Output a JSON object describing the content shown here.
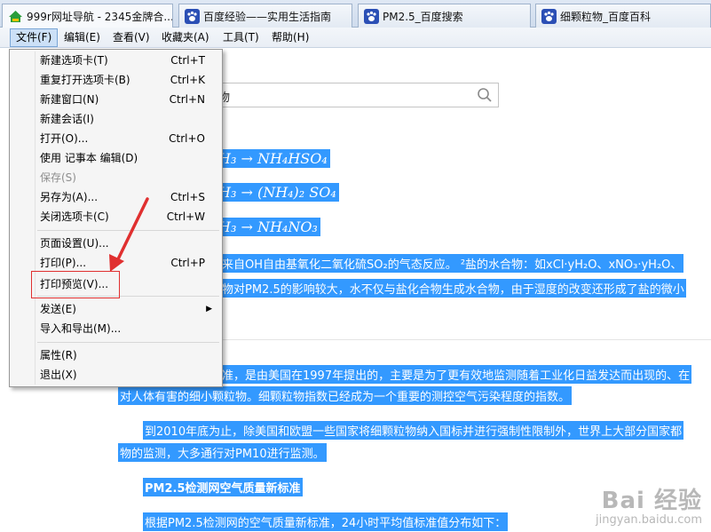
{
  "tabs": [
    {
      "label": "999r网址导航 - 2345金牌合...",
      "icon": "site-2345-icon"
    },
    {
      "label": "百度经验——实用生活指南",
      "icon": "baidu-paw-icon"
    },
    {
      "label": "PM2.5_百度搜索",
      "icon": "baidu-paw-icon"
    },
    {
      "label": "细颗粒物_百度百科",
      "icon": "baidu-paw-icon"
    }
  ],
  "menubar": {
    "file": "文件(F)",
    "edit": "编辑(E)",
    "view": "查看(V)",
    "favorites": "收藏夹(A)",
    "tools": "工具(T)",
    "help": "帮助(H)"
  },
  "file_menu": {
    "new_tab": {
      "label": "新建选项卡(T)",
      "shortcut": "Ctrl+T"
    },
    "reopen_tab": {
      "label": "重复打开选项卡(B)",
      "shortcut": "Ctrl+K"
    },
    "new_window": {
      "label": "新建窗口(N)",
      "shortcut": "Ctrl+N"
    },
    "new_session": {
      "label": "新建会话(I)"
    },
    "open": {
      "label": "打开(O)...",
      "shortcut": "Ctrl+O"
    },
    "edit_with": {
      "label": "使用 记事本 编辑(D)"
    },
    "save": {
      "label": "保存(S)"
    },
    "save_as": {
      "label": "另存为(A)...",
      "shortcut": "Ctrl+S"
    },
    "close_tab": {
      "label": "关闭选项卡(C)",
      "shortcut": "Ctrl+W"
    },
    "page_setup": {
      "label": "页面设置(U)..."
    },
    "print": {
      "label": "打印(P)...",
      "shortcut": "Ctrl+P"
    },
    "print_preview": {
      "label": "打印预览(V)..."
    },
    "send": {
      "label": "发送(E)"
    },
    "import_export": {
      "label": "导入和导出(M)..."
    },
    "properties": {
      "label": "属性(R)"
    },
    "exit": {
      "label": "退出(X)"
    }
  },
  "search": {
    "value": "物"
  },
  "content": {
    "formula1": "H₃ → NH₄HSO₄",
    "formula2": "H₃ → (NH₄)₂ SO₄",
    "formula3": "H₃ → NH₄NO₃",
    "para1_line1": "来自OH自由基氧化二氧化硫SO₂的气态反应。 ²盐的水合物：如xCl·yH₂O、xNO₃·yH₂O、",
    "para1_line2": "物对PM2.5的影响较大，水不仅与盐化合物生成水合物，由于湿度的改变还形成了盐的微小",
    "para2_line1": "准，是由美国在1997年提出的，主要是为了更有效地监测随着工业化日益发达而出现的、在",
    "para2_line2": "对人体有害的细小颗粒物。细颗粒物指数已经成为一个重要的测控空气污染程度的指数。",
    "para3_line1": "到2010年底为止，除美国和欧盟一些国家将细颗粒物纳入国标并进行强制性限制外，世界上大部分国家都",
    "para3_line2": "物的监测，大多通行对PM10进行监测。",
    "heading": "PM2.5检测网空气质量新标准",
    "para4_line1": "根据PM2.5检测网的空气质量新标准，24小时平均值标准值分布如下："
  },
  "watermark": {
    "brand": "Bai 经验",
    "url": "jingyan.baidu.com"
  },
  "colors": {
    "highlight": "#3399ff",
    "annotation_red": "#e03030"
  }
}
